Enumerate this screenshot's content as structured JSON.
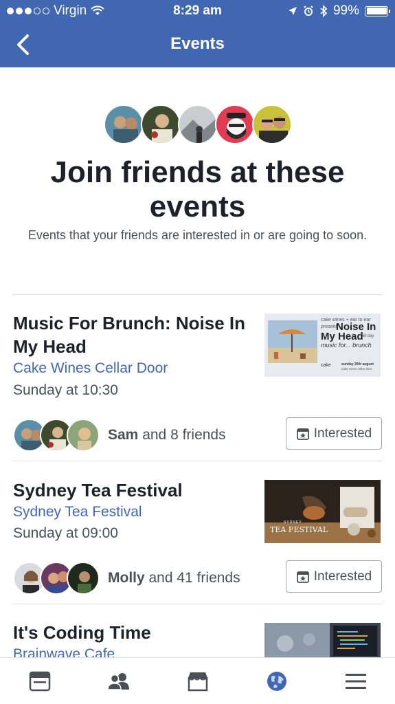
{
  "status_bar": {
    "carrier": "Virgin",
    "time": "8:29 am",
    "battery": "99%"
  },
  "nav": {
    "title": "Events",
    "back_icon": "chevron-left-icon"
  },
  "hero": {
    "title": "Join friends at these events",
    "subtitle": "Events that your friends are interested in or are going to soon."
  },
  "events": [
    {
      "title": "Music For Brunch: Noise In My Head",
      "venue": "Cake Wines Cellar Door",
      "time": "Sunday at 10:30",
      "thumb": {
        "line1": "cake wines + ear to ear",
        "line2": "present",
        "headline1": "Noise In",
        "headline2": "My Head",
        "allday": "all day",
        "tag": "music for... brunch",
        "footer_brand": "cake",
        "footer_date": "sunday 20th august",
        "footer_place": "cake wines cellar door"
      },
      "friends_name": "Sam",
      "friends_rest": " and 8 friends",
      "button": "Interested"
    },
    {
      "title": "Sydney Tea Festival",
      "venue": "Sydney Tea Festival",
      "time": "Sunday at 09:00",
      "thumb": {
        "small": "SYDNEY",
        "big": "TEA FESTIVAL"
      },
      "friends_name": "Molly",
      "friends_rest": " and 41 friends",
      "button": "Interested"
    },
    {
      "title": "It's Coding Time",
      "venue": "Brainwave Cafe"
    }
  ],
  "tabbar": [
    "news-feed-icon",
    "friends-icon",
    "marketplace-icon",
    "globe-icon",
    "menu-icon"
  ],
  "colors": {
    "brand": "#4267b2",
    "text": "#1d2129",
    "secondary": "#4b4f56"
  }
}
